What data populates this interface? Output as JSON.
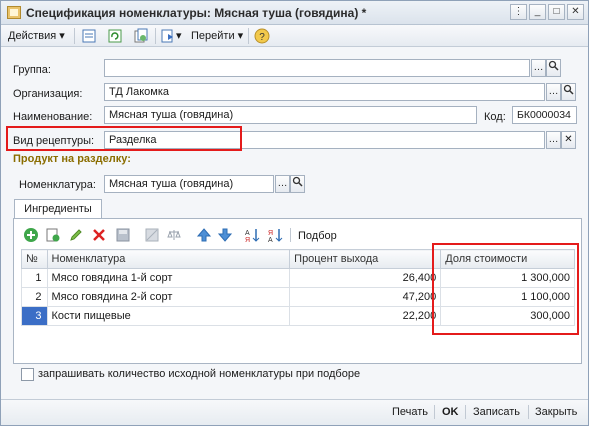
{
  "window": {
    "title": "Спецификация номенклатуры: Мясная туша (говядина) *"
  },
  "toolbar": {
    "actions_label": "Действия",
    "goto_label": "Перейти"
  },
  "form": {
    "group_label": "Группа:",
    "group_value": "",
    "org_label": "Организация:",
    "org_value": "ТД Лакомка",
    "name_label": "Наименование:",
    "name_value": "Мясная туша (говядина)",
    "code_label": "Код:",
    "code_value": "БК0000034",
    "recipe_type_label": "Вид рецептуры:",
    "recipe_type_value": "Разделка"
  },
  "product_section": {
    "title": "Продукт на разделку:",
    "nomenclature_label": "Номенклатура:",
    "nomenclature_value": "Мясная туша (говядина)"
  },
  "tabs": [
    {
      "label": "Ингредиенты"
    }
  ],
  "ingredients_toolbar": {
    "pick_label": "Подбор"
  },
  "table": {
    "columns": [
      "№",
      "Номенклатура",
      "Процент выхода",
      "Доля стоимости"
    ],
    "rows": [
      {
        "n": "1",
        "name": "Мясо говядина 1-й сорт",
        "yield": "26,400",
        "share": "1 300,000"
      },
      {
        "n": "2",
        "name": "Мясо говядина 2-й сорт",
        "yield": "47,200",
        "share": "1 100,000"
      },
      {
        "n": "3",
        "name": "Кости пищевые",
        "yield": "22,200",
        "share": "300,000"
      }
    ]
  },
  "checkbox": {
    "label": "запрашивать количество исходной номенклатуры при подборе",
    "checked": false
  },
  "bottom": {
    "print_label": "Печать",
    "ok_label": "OK",
    "save_label": "Записать",
    "close_label": "Закрыть"
  }
}
